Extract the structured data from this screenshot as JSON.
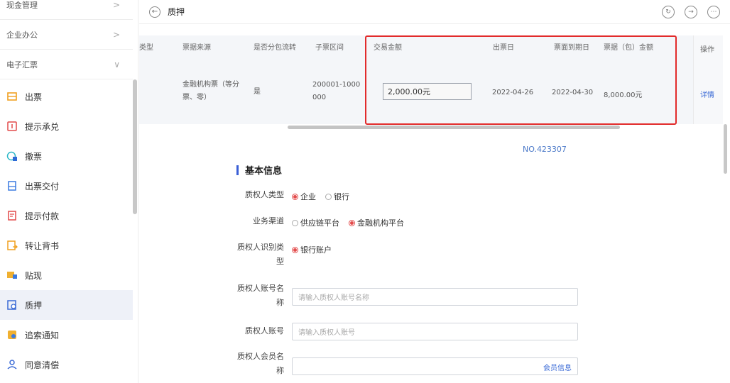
{
  "sidebar": {
    "groups": [
      {
        "label": "现金管理",
        "chevron": ">"
      },
      {
        "label": "企业办公",
        "chevron": ">"
      },
      {
        "label": "电子汇票",
        "chevron": "∨"
      }
    ],
    "items": [
      {
        "label": "出票",
        "icon": "issue-bill-icon"
      },
      {
        "label": "提示承兑",
        "icon": "prompt-accept-icon"
      },
      {
        "label": "撤票",
        "icon": "revoke-icon"
      },
      {
        "label": "出票交付",
        "icon": "deliver-icon"
      },
      {
        "label": "提示付款",
        "icon": "prompt-pay-icon"
      },
      {
        "label": "转让背书",
        "icon": "endorse-icon"
      },
      {
        "label": "贴现",
        "icon": "discount-icon"
      },
      {
        "label": "质押",
        "icon": "pledge-icon",
        "active": true
      },
      {
        "label": "追索通知",
        "icon": "recourse-icon"
      },
      {
        "label": "同意清偿",
        "icon": "agree-pay-icon"
      }
    ]
  },
  "header": {
    "title": "质押",
    "back_icon": "back-icon",
    "actions": [
      "refresh-icon",
      "export-icon",
      "more-icon"
    ]
  },
  "table": {
    "columns": [
      "类型",
      "票据来源",
      "是否分包流转",
      "子票区间",
      "交易金额",
      "出票日",
      "票面到期日",
      "票据（包）金额",
      "操作"
    ],
    "row": {
      "source": "金融机构票（等分票、零）",
      "split_transfer": "是",
      "sub_range": "200001-1000000",
      "amount": "2,000.00元",
      "issue_date": "2022-04-26",
      "due_date": "2022-04-30",
      "bill_amount": "8,000.00元",
      "action": "详情"
    },
    "highlight_color": "#e22b2b"
  },
  "form": {
    "no": "NO.423307",
    "section_title": "基本信息",
    "pledgee_type": {
      "label": "质权人类型",
      "options": [
        "企业",
        "银行"
      ],
      "selected": "企业"
    },
    "business_channel": {
      "label": "业务渠道",
      "options": [
        "供应链平台",
        "金融机构平台"
      ],
      "selected": "金融机构平台"
    },
    "id_type": {
      "label_line1": "质权人识别类",
      "label_line2": "型",
      "options": [
        "银行账户"
      ],
      "selected": "银行账户"
    },
    "account_name": {
      "label_line1": "质权人账号名",
      "label_line2": "称",
      "placeholder": "请输入质权人账号名称"
    },
    "account_no": {
      "label": "质权人账号",
      "placeholder": "请输入质权人账号"
    },
    "member_name": {
      "label_line1": "质权人会员名",
      "label_line2": "称",
      "link": "会员信息"
    }
  },
  "colors": {
    "accent": "#3a5fd6",
    "radio_on": "#e34b4b",
    "link": "#3a6ad6",
    "active_bg": "#eef1f8"
  }
}
